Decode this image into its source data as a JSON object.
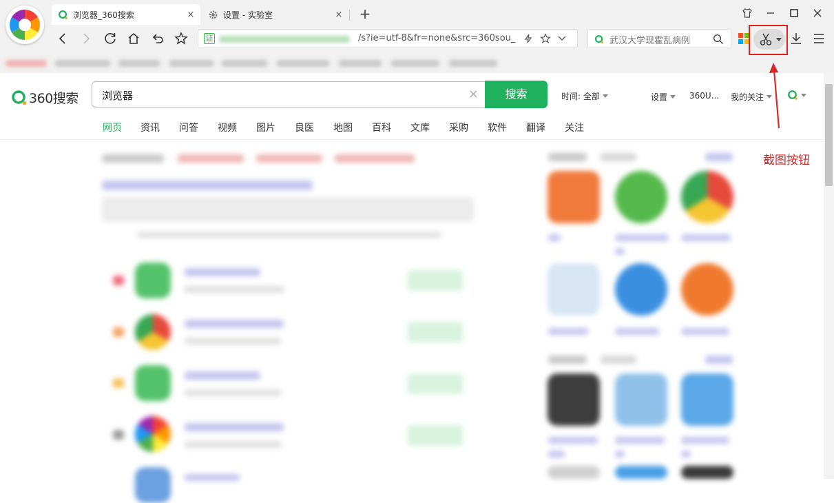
{
  "browser": {
    "tabs": [
      {
        "title": "浏览器_360搜索",
        "active": true
      },
      {
        "title": "设置 - 实验室",
        "active": false
      }
    ],
    "address_text": "/s?ie=utf-8&fr=none&src=360sou_",
    "cert_label": "证",
    "search_box_text": "武汉大学现霍乱病例",
    "close_glyph": "×",
    "newtab_glyph": "+"
  },
  "page": {
    "brand": "360搜索",
    "query": "浏览器",
    "search_button": "搜索",
    "time_filter": "时间: 全部",
    "header_links": {
      "settings": "设置",
      "user": "360U...",
      "following": "我的关注"
    },
    "vertical_tabs": [
      "网页",
      "资讯",
      "问答",
      "视频",
      "图片",
      "良医",
      "地图",
      "百科",
      "文库",
      "采购",
      "软件",
      "翻译",
      "关注"
    ],
    "active_tab": "网页"
  },
  "annotation": {
    "label": "截图按钮",
    "color": "#d42a2a"
  },
  "colors": {
    "accent_green": "#20b15e",
    "highlight_red": "#e02020"
  }
}
